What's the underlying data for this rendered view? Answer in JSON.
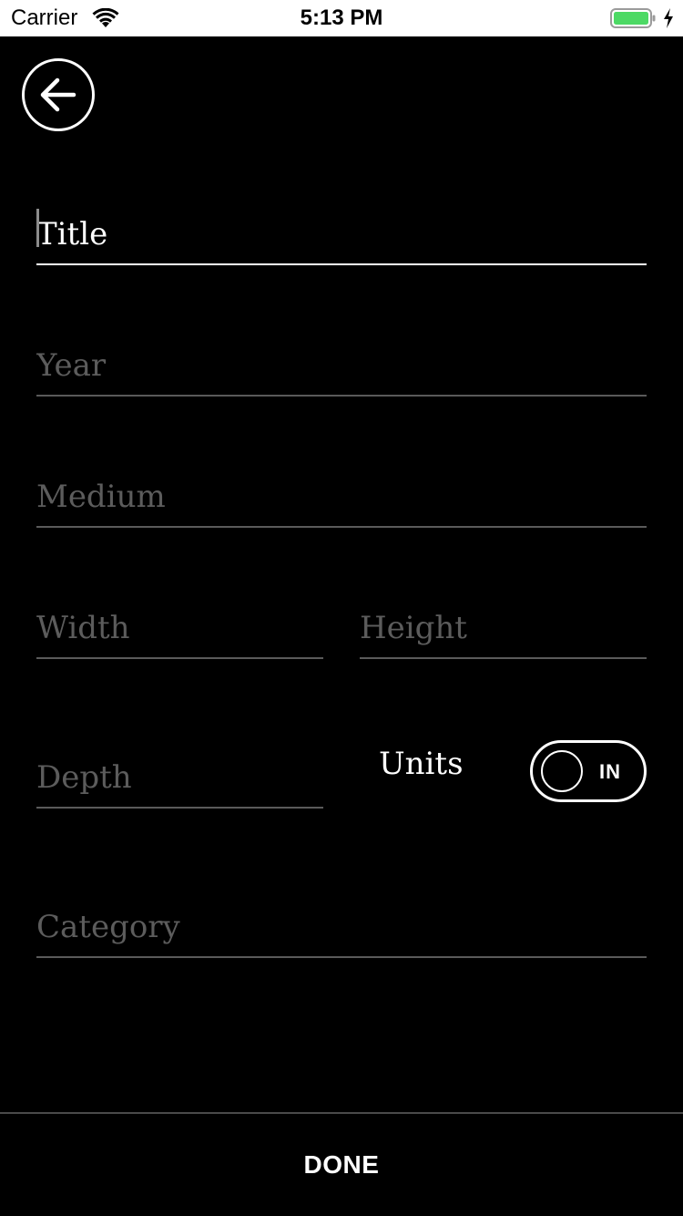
{
  "status_bar": {
    "carrier": "Carrier",
    "time": "5:13 PM",
    "battery_color": "#4cd964"
  },
  "header": {
    "back_icon": "arrow-left-icon"
  },
  "form": {
    "title_placeholder": "Title",
    "title_value": "",
    "year_placeholder": "Year",
    "year_value": "",
    "medium_placeholder": "Medium",
    "medium_value": "",
    "width_placeholder": "Width",
    "width_value": "",
    "height_placeholder": "Height",
    "height_value": "",
    "depth_placeholder": "Depth",
    "depth_value": "",
    "units_label": "Units",
    "units_toggle_value": "IN",
    "category_placeholder": "Category",
    "category_value": ""
  },
  "footer": {
    "done_label": "DONE"
  },
  "colors": {
    "background": "#000000",
    "text": "#ffffff",
    "placeholder": "#5c5c5c",
    "underline": "#5a5a5a",
    "active_underline": "#ffffff"
  }
}
